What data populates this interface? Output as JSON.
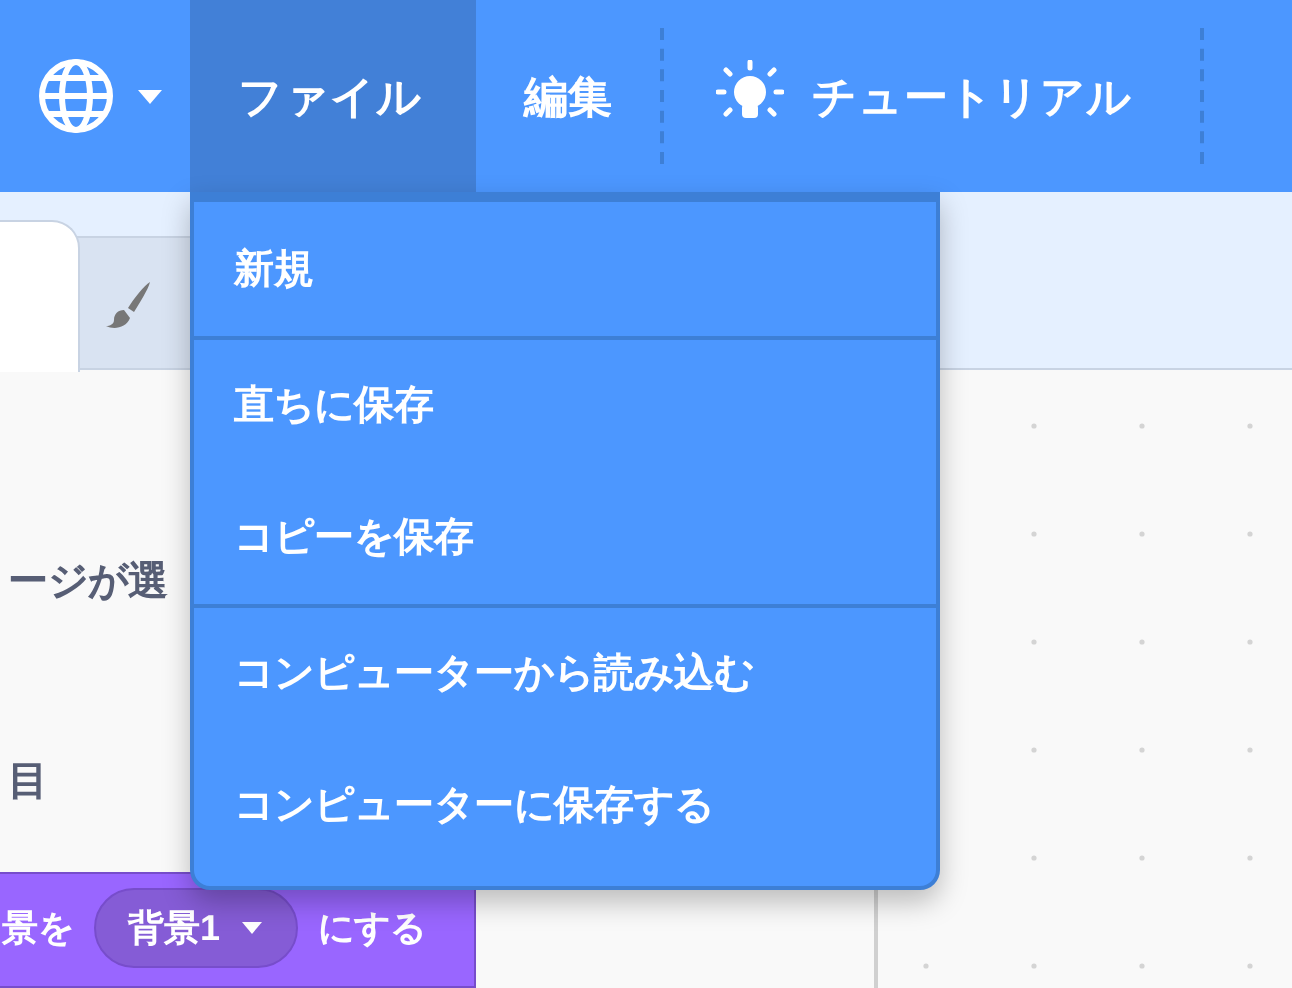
{
  "menu_bar": {
    "items": [
      {
        "label": "ファイル",
        "kind": "menu",
        "selected": true
      },
      {
        "label": "編集",
        "kind": "menu",
        "selected": false
      },
      {
        "label": "チュートリアル",
        "kind": "tutorial",
        "selected": false
      }
    ]
  },
  "tabs": [
    {
      "selected": true
    },
    {
      "selected": false
    }
  ],
  "file_menu": {
    "groups": [
      {
        "items": [
          {
            "label": "新規"
          }
        ]
      },
      {
        "items": [
          {
            "label": "直ちに保存"
          },
          {
            "label": "コピーを保存"
          }
        ]
      },
      {
        "items": [
          {
            "label": "コンピューターから読み込む"
          },
          {
            "label": "コンピューターに保存する"
          }
        ]
      }
    ]
  },
  "code_area": {
    "texts": [
      "ージが選",
      "目"
    ],
    "block": {
      "parts": [
        {
          "kind": "text",
          "text": "景を"
        },
        {
          "kind": "dropdown",
          "text": "背景1"
        },
        {
          "kind": "text",
          "text": "にする"
        }
      ]
    }
  }
}
